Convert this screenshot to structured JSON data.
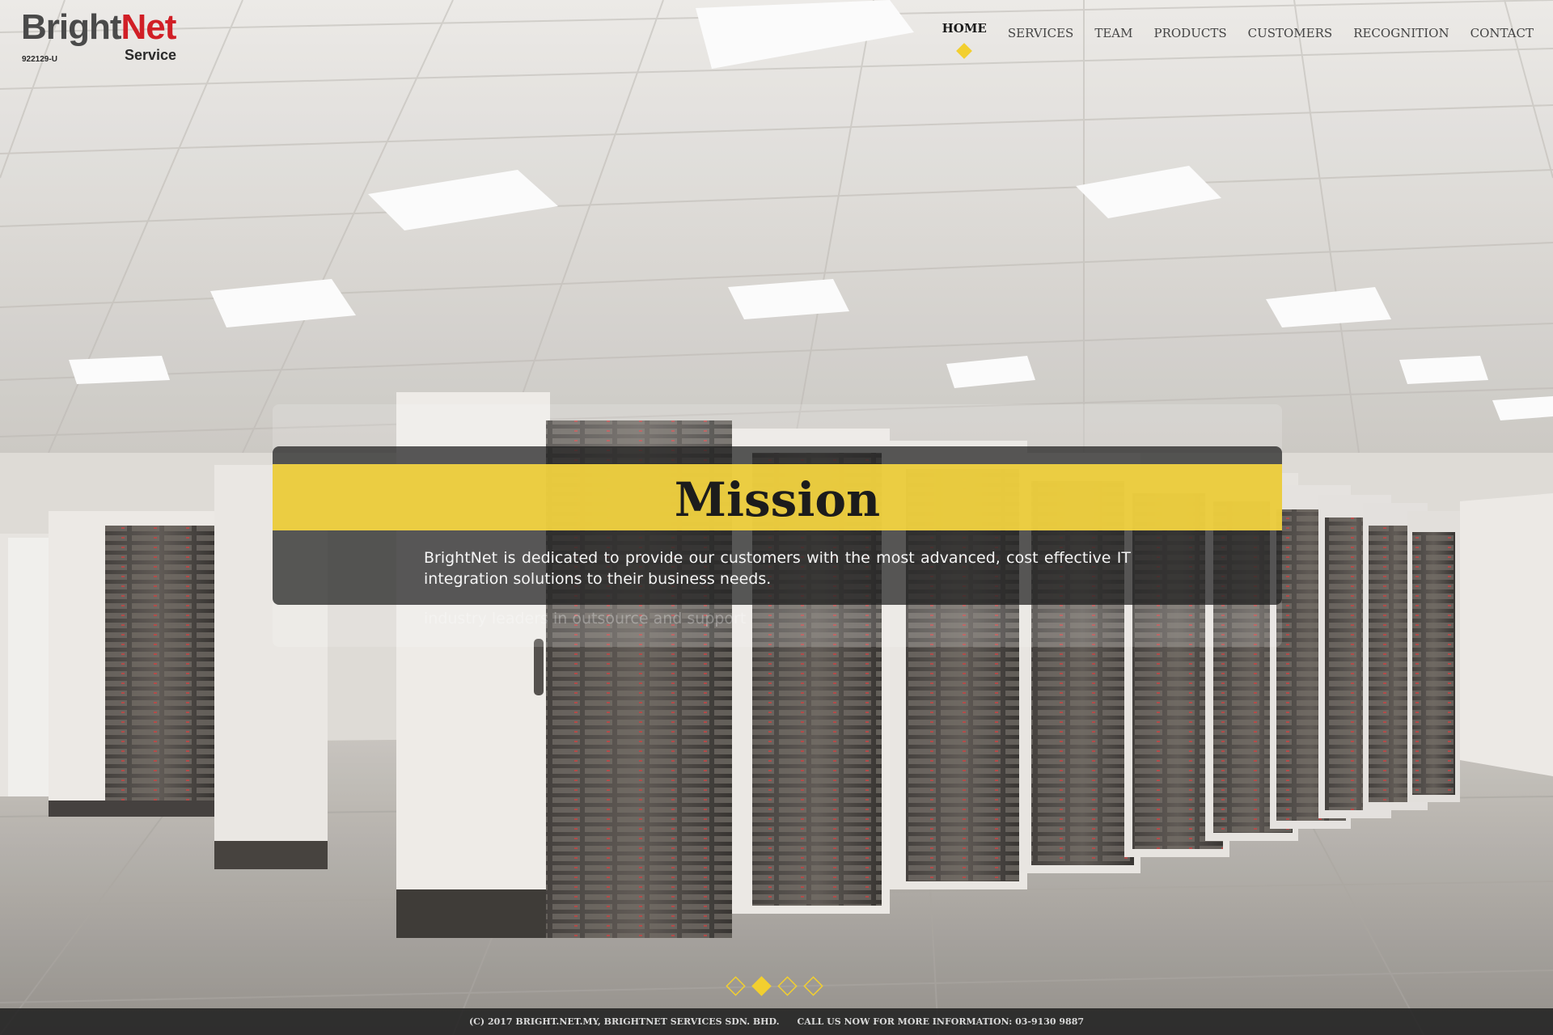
{
  "logo": {
    "brand_part1": "Bright",
    "brand_part2": "Net",
    "tagline": "Service",
    "registration": "922129-U"
  },
  "nav": {
    "items": [
      {
        "label": "HOME",
        "active": true
      },
      {
        "label": "SERVICES",
        "active": false
      },
      {
        "label": "TEAM",
        "active": false
      },
      {
        "label": "PRODUCTS",
        "active": false
      },
      {
        "label": "CUSTOMERS",
        "active": false
      },
      {
        "label": "RECOGNITION",
        "active": false
      },
      {
        "label": "CONTACT",
        "active": false
      }
    ]
  },
  "hero": {
    "title": "Mission",
    "body": "BrightNet is dedicated to provide our customers with the most advanced, cost effective IT integration solutions to their business needs.",
    "ghost_text": "industry leaders in outsource and support"
  },
  "slider": {
    "count": 4,
    "active_index": 1
  },
  "footer": {
    "copyright": "(C) 2017 BRIGHT.NET.MY, BRIGHTNET SERVICES SDN. BHD.",
    "call": "CALL US NOW FOR MORE INFORMATION: 03-9130 9887"
  },
  "colors": {
    "accent_yellow": "#f2cf2f",
    "brand_red": "#d11f26",
    "brand_gray": "#4a4a4a"
  }
}
